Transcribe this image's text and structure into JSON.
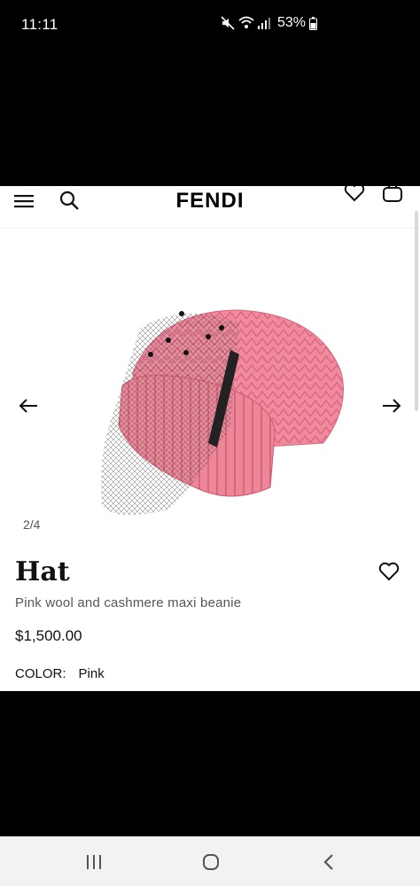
{
  "status_bar": {
    "time": "11:11",
    "battery": "53%"
  },
  "header": {
    "brand": "FENDI"
  },
  "gallery": {
    "counter": "2/4"
  },
  "product": {
    "title": "Hat",
    "description": "Pink wool and cashmere maxi beanie",
    "price": "$1,500.00",
    "color_label": "COLOR:",
    "color_value": "Pink"
  },
  "colors": {
    "hat_pink": "#f08a9e",
    "hat_shadow": "#d9667c",
    "text_primary": "#111111",
    "text_secondary": "#555555"
  }
}
